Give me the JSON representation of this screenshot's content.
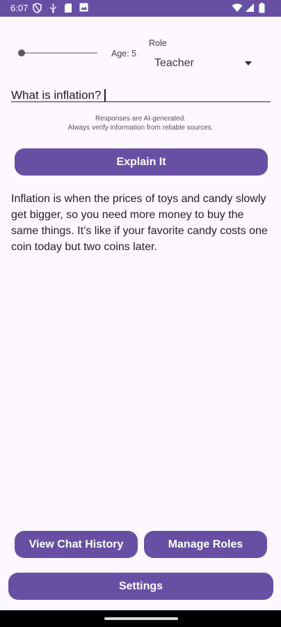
{
  "status_bar": {
    "time": "6:07",
    "left_icons": [
      "shield-icon",
      "usb-icon",
      "sd-card-icon",
      "image-icon"
    ],
    "right_icons": [
      "wifi-icon",
      "signal-icon",
      "battery-icon"
    ],
    "color": "#6750a4"
  },
  "controls": {
    "age_label": "Age: 5",
    "age_value": 5,
    "age_slider_fraction": 0.0,
    "role_caption": "Role",
    "role_value": "Teacher"
  },
  "question": {
    "value": "What is inflation?"
  },
  "disclaimer": {
    "line1": "Responses are AI-generated.",
    "line2": "Always verify information from reliable sources."
  },
  "explain_button": "Explain It",
  "response_text": "Inflation is when the prices of toys and candy slowly get bigger, so you need more money to buy the same things. It’s like if your favorite candy costs one coin today but two coins later.",
  "footer": {
    "history_label": "View Chat History",
    "roles_label": "Manage Roles",
    "settings_label": "Settings"
  },
  "colors": {
    "accent": "#6750a4",
    "background": "#fdf7ff"
  }
}
